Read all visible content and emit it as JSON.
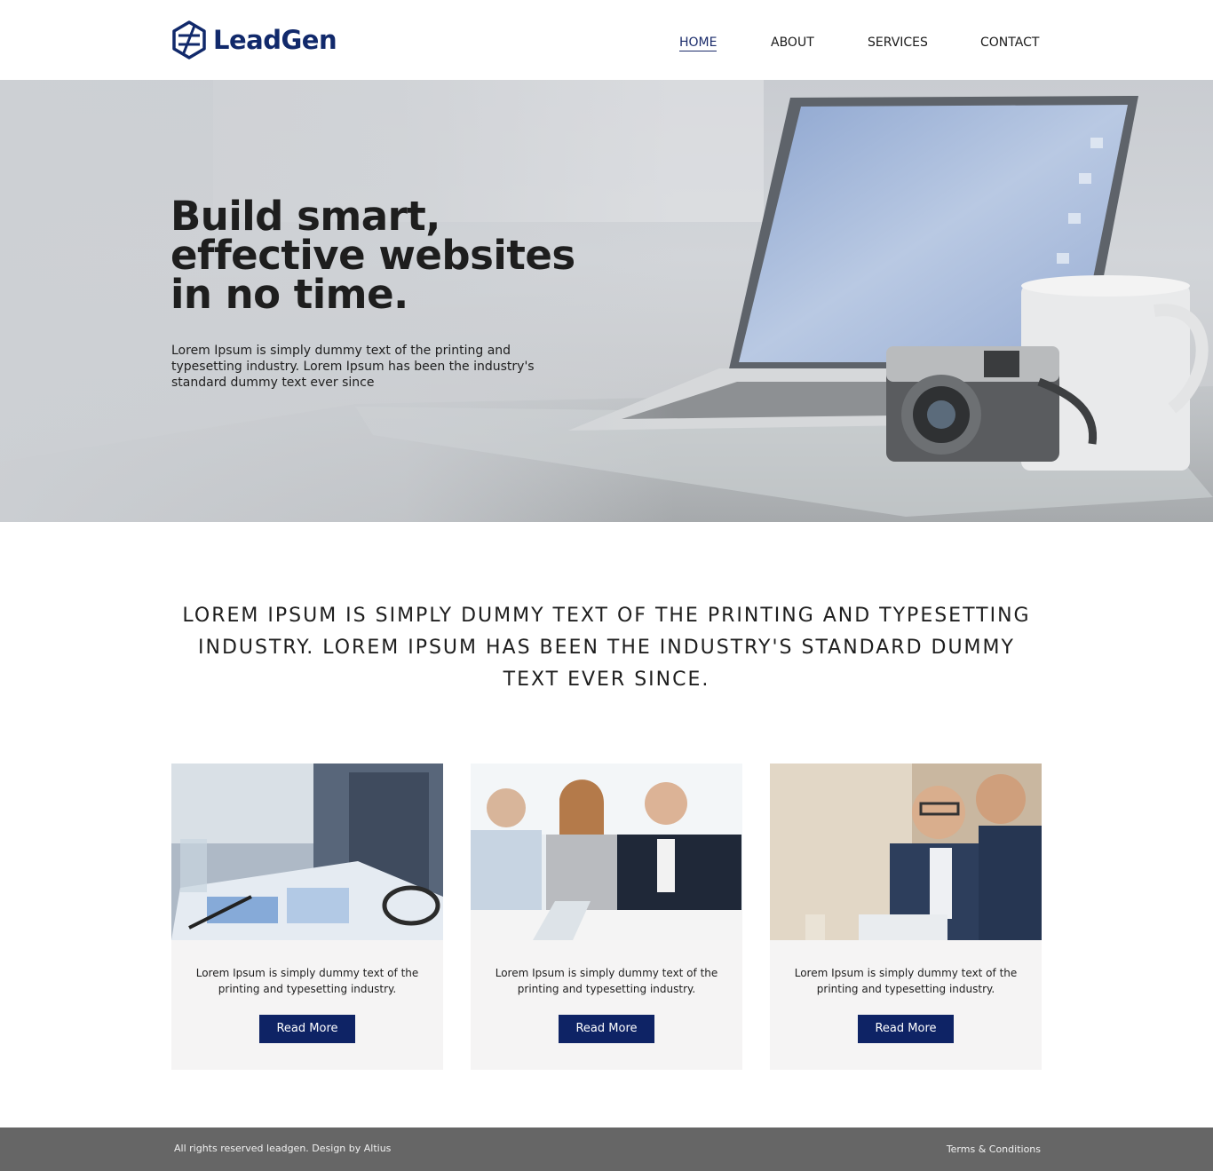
{
  "brand": {
    "name": "LeadGen",
    "color": "#11296b"
  },
  "nav": {
    "items": [
      {
        "label": "HOME",
        "active": true
      },
      {
        "label": "ABOUT"
      },
      {
        "label": "SERVICES"
      },
      {
        "label": "CONTACT"
      }
    ]
  },
  "hero": {
    "title_lines": [
      "Build smart,",
      "effective websites",
      "in no time."
    ],
    "description": "Lorem Ipsum is simply dummy text of the printing and typesetting industry. Lorem Ipsum has been the industry's standard dummy text ever since"
  },
  "intro": {
    "text": "LOREM IPSUM IS SIMPLY DUMMY TEXT OF THE PRINTING AND TYPESETTING INDUSTRY. LOREM IPSUM HAS BEEN THE INDUSTRY'S STANDARD DUMMY TEXT EVER SINCE."
  },
  "cards": [
    {
      "text": "Lorem Ipsum is simply dummy text of the printing and typesetting industry.",
      "button": "Read More"
    },
    {
      "text": "Lorem Ipsum is simply dummy text of the printing and typesetting industry.",
      "button": "Read More"
    },
    {
      "text": "Lorem Ipsum is simply dummy text of the printing and typesetting industry.",
      "button": "Read More"
    }
  ],
  "footer": {
    "left": "All rights reserved leadgen. Design by Altius",
    "right": "Terms & Conditions"
  },
  "colors": {
    "accent": "#0e2365",
    "footer_bg": "#666666"
  }
}
